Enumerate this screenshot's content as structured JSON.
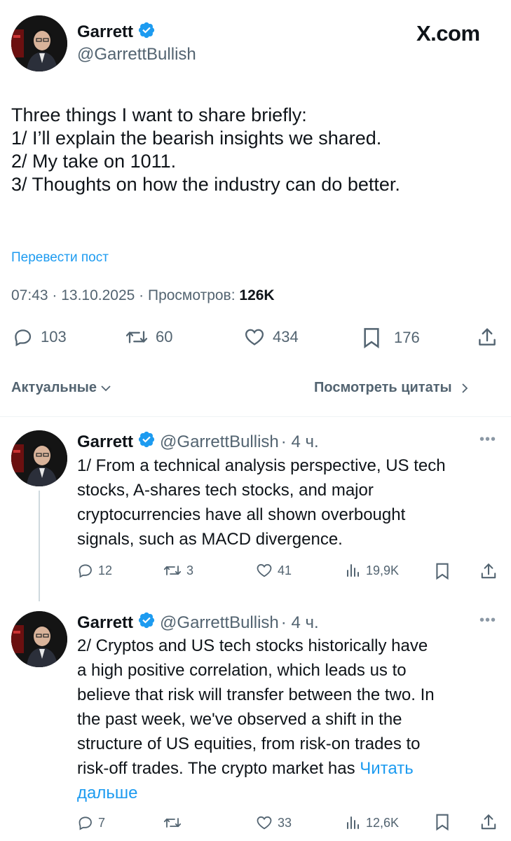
{
  "site_logo": "X.com",
  "main_post": {
    "author_name": "Garrett",
    "author_handle": "@GarrettBullish",
    "lines": [
      "Three things I want to share briefly:",
      "1/ I’ll explain the bearish insights we shared.",
      "2/ My take on 1011.",
      "3/ Thoughts on how the industry can do better."
    ],
    "translate_label": "Перевести пост",
    "timestamp": "07:43 · 13.10.2025 · Просмотров: ",
    "views": "126K",
    "stats": {
      "replies": "103",
      "reposts": "60",
      "likes": "434",
      "bookmarks": "176"
    }
  },
  "sort": {
    "label": "Актуальные",
    "quotes_label": "Посмотреть цитаты"
  },
  "replies": [
    {
      "author_name": "Garrett",
      "author_handle": "@GarrettBullish",
      "time": "· 4 ч.",
      "lines": [
        "1/ From a technical analysis perspective, US tech",
        "stocks, A-shares tech stocks, and major",
        "cryptocurrencies have all shown overbought",
        "signals, such as MACD divergence."
      ],
      "stats": {
        "replies": "12",
        "reposts": "3",
        "likes": "41",
        "views": "19,9K"
      }
    },
    {
      "author_name": "Garrett",
      "author_handle": "@GarrettBullish",
      "time": "· 4 ч.",
      "lines": [
        "2/ Cryptos and US tech stocks historically have",
        "a high positive correlation, which leads us to",
        "believe that risk will transfer between the two. In",
        "the past week, we've observed a shift in the",
        "structure of US equities, from risk-on trades to",
        "risk-off trades. The crypto market has "
      ],
      "read_more_1": "Читать",
      "read_more_2": "дальше",
      "stats": {
        "replies": "7",
        "reposts": "",
        "likes": "33",
        "views": "12,6K"
      }
    }
  ],
  "colors": {
    "accent": "#1d9bf0",
    "text": "#0f1419",
    "secondary": "#536471"
  }
}
